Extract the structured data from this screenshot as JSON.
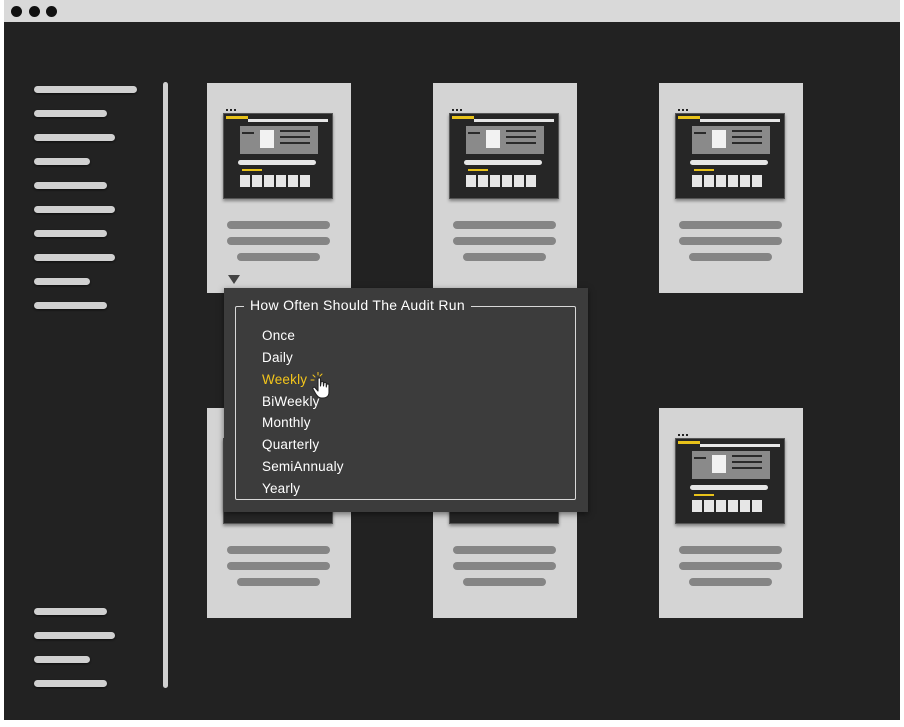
{
  "window": {
    "title_dots": [
      "close",
      "minimize",
      "maximize"
    ]
  },
  "sidebar": {
    "item_count_top": 10,
    "item_count_bottom": 4
  },
  "cards": [
    {
      "id": "card-1",
      "icon": "app-screenshot-thumbnail"
    },
    {
      "id": "card-2",
      "icon": "app-screenshot-thumbnail"
    },
    {
      "id": "card-3",
      "icon": "app-screenshot-thumbnail"
    },
    {
      "id": "card-4",
      "icon": "app-screenshot-thumbnail"
    },
    {
      "id": "card-5",
      "icon": "app-screenshot-thumbnail"
    },
    {
      "id": "card-6",
      "icon": "app-screenshot-thumbnail"
    }
  ],
  "dropdown": {
    "legend": "How Often Should The Audit Run",
    "options": [
      "Once",
      "Daily",
      "Weekly",
      "BiWeekly",
      "Monthly",
      "Quarterly",
      "SemiAnnualy",
      "Yearly"
    ],
    "hovered": "Weekly",
    "hover_icon": "hand-pointer-icon"
  },
  "colors": {
    "accent": "#f3c51b",
    "background": "#222222",
    "card": "#d4d4d4",
    "panel": "#3c3c3c"
  }
}
